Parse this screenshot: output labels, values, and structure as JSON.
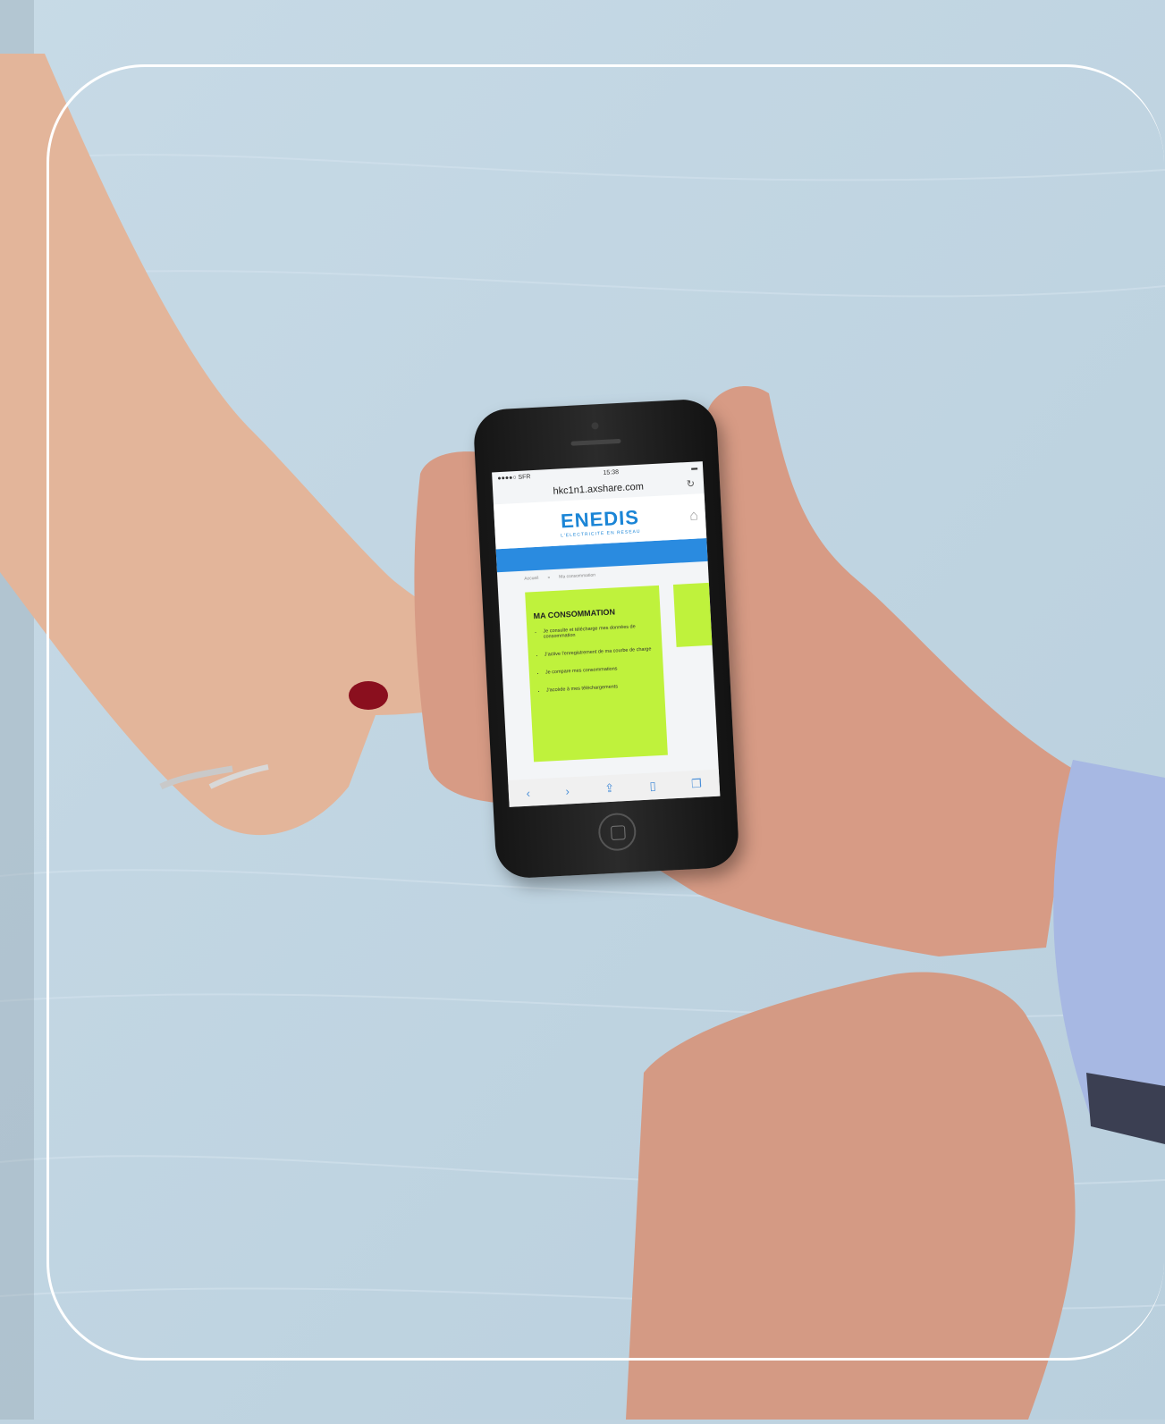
{
  "phone": {
    "status": {
      "carrier": "●●●●○ SFR",
      "time": "15:38"
    },
    "url": "hkc1n1.axshare.com",
    "site": {
      "logo": "ENEDIS",
      "logo_sub": "L'ELECTRICITE EN RESEAU",
      "breadcrumb": [
        "Accueil",
        "Ma consommation"
      ],
      "panel_title": "MA CONSOMMATION",
      "items": [
        "Je consulte et télécharge mes données de consommation",
        "J'active l'enregistrement de ma courbe de charge",
        "Je compare mes consommations",
        "J'accède à mes téléchargements"
      ]
    }
  },
  "colors": {
    "table": "#bfd3e0",
    "enedis_blue": "#2a8be0",
    "enedis_green": "#bff23c",
    "frame": "#ffffff"
  }
}
